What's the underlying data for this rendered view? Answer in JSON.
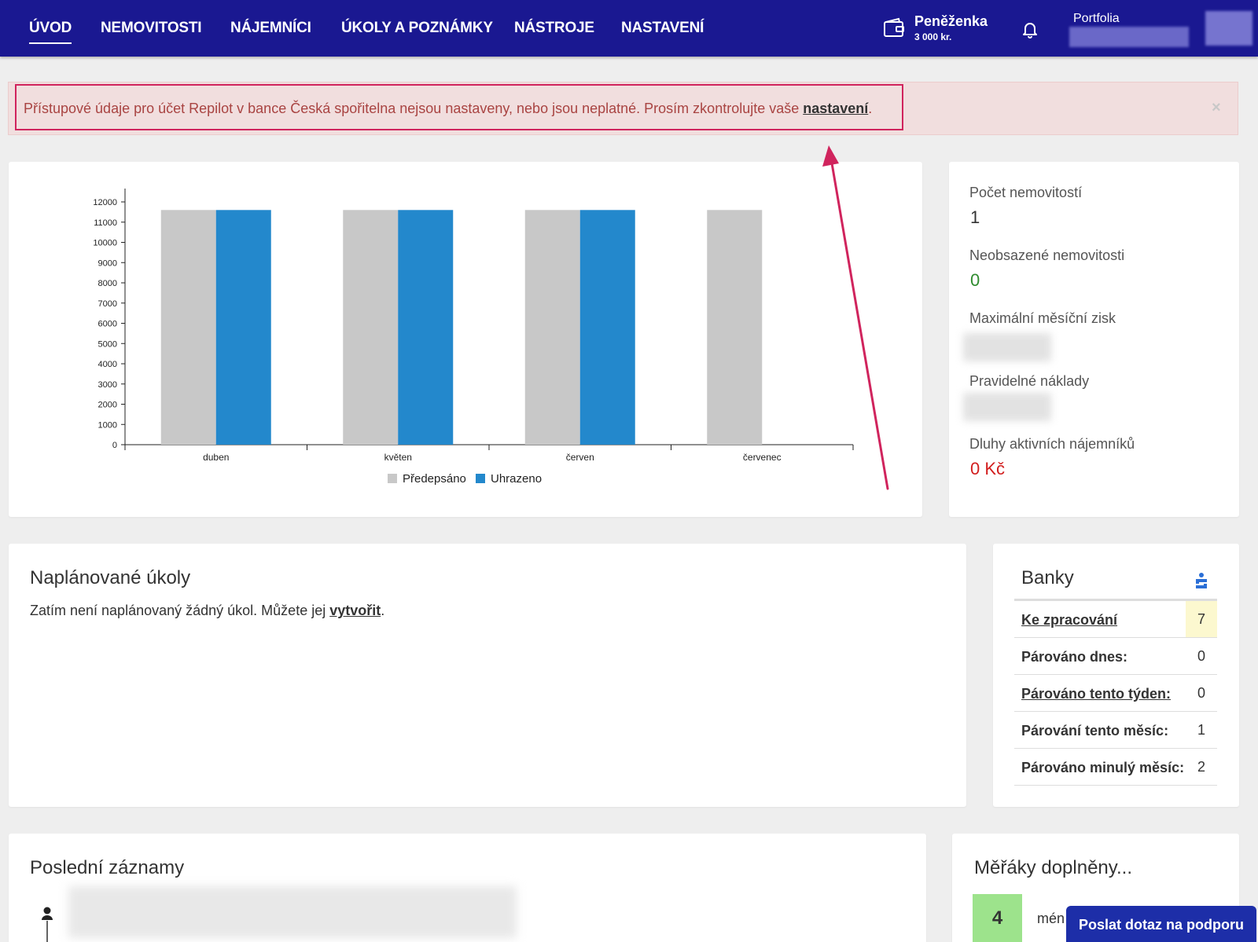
{
  "nav": {
    "items": [
      "ÚVOD",
      "NEMOVITOSTI",
      "NÁJEMNÍCI",
      "ÚKOLY A POZNÁMKY",
      "NÁSTROJE",
      "NASTAVENÍ"
    ],
    "active_index": 0,
    "wallet_title": "Peněženka",
    "wallet_amount": "3 000 kr.",
    "portfolio_label": "Portfolia",
    "icons": [
      "wallet-icon",
      "bell-icon"
    ]
  },
  "alert": {
    "text": "Přístupové údaje pro účet Repilot  v bance Česká spořitelna nejsou nastaveny, nebo jsou neplatné. Prosím zkontrolujte vaše ",
    "link": "nastavení",
    "suffix": ".",
    "close": "×",
    "box_color": "#d0245d"
  },
  "chart_data": {
    "type": "bar",
    "categories": [
      "duben",
      "květen",
      "červen",
      "červenec"
    ],
    "series": [
      {
        "name": "Předepsáno",
        "color": "#c8c8c8",
        "values": [
          11600,
          11600,
          11600,
          11600
        ]
      },
      {
        "name": "Uhrazeno",
        "color": "#2388cc",
        "values": [
          11600,
          11600,
          11600,
          null
        ]
      }
    ],
    "yticks": [
      "12000",
      "11000",
      "10000",
      "9000",
      "8000",
      "7000",
      "6000",
      "5000",
      "4000",
      "3000",
      "2000",
      "1000",
      "0"
    ],
    "ylim": [
      0,
      12000
    ],
    "legend": "bottom"
  },
  "stats": {
    "count_label": "Počet nemovitostí",
    "count_value": "1",
    "vacant_label": "Neobsazené nemovitosti",
    "vacant_value": "0",
    "vacant_color": "#2e8b2e",
    "max_profit_label": "Maximální měsíční zisk",
    "costs_label": "Pravidelné náklady",
    "debts_label": "Dluhy aktivních nájemníků",
    "debts_value": "0 Kč",
    "debts_color": "#d21e1e"
  },
  "tasks": {
    "title": "Naplánované úkoly",
    "text": "Zatím není naplánovaný žádný úkol. Můžete jej ",
    "link": "vytvořit",
    "suffix": "."
  },
  "banks": {
    "title": "Banky",
    "rows": [
      {
        "label": "Ke zpracování",
        "value": "7"
      },
      {
        "label": "Párováno dnes:",
        "value": "0"
      },
      {
        "label": "Párováno tento týden:",
        "value": "0"
      },
      {
        "label": "Párování tento měsíc:",
        "value": "1"
      },
      {
        "label": "Párováno minulý měsíc:",
        "value": "2"
      }
    ]
  },
  "records": {
    "title": "Poslední záznamy"
  },
  "meters": {
    "title": "Měřáky doplněny...",
    "count": "4",
    "text": "mén"
  },
  "support": {
    "label": "Poslat dotaz na podporu"
  }
}
